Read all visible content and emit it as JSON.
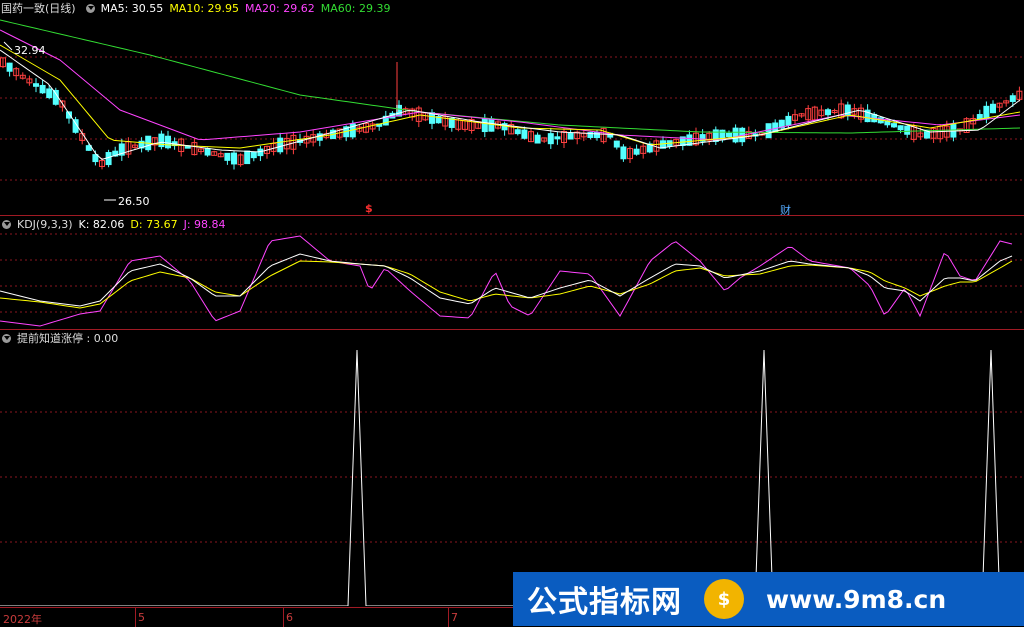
{
  "price_header": {
    "stock": "国药一致(日线)",
    "ma5": "MA5: 30.55",
    "ma10": "MA10: 29.95",
    "ma20": "MA20: 29.62",
    "ma60": "MA60: 29.39"
  },
  "price_annotations": {
    "high": "32.94",
    "low": "26.50",
    "marker_s": "$",
    "marker_cai": "财"
  },
  "kdj_header": {
    "name": "KDJ(9,3,3)",
    "k": "K: 82.06",
    "d": "D: 73.67",
    "j": "J: 98.84"
  },
  "indicator_header": {
    "name": "提前知道涨停 : 0.00"
  },
  "axis": {
    "labels": [
      "2022年",
      "5",
      "6",
      "7"
    ]
  },
  "watermark": {
    "left": "公式指标网",
    "logo": "$",
    "right": "www.9m8.cn"
  },
  "colors": {
    "up": "#ff4040",
    "down": "#54ffff",
    "ma5": "#ffffff",
    "ma10": "#ffff00",
    "ma20": "#ff44ff",
    "ma60": "#33dd33",
    "k": "#ffffff",
    "d": "#ffff00",
    "j": "#ff44ff",
    "grid": "#8a1620"
  }
}
